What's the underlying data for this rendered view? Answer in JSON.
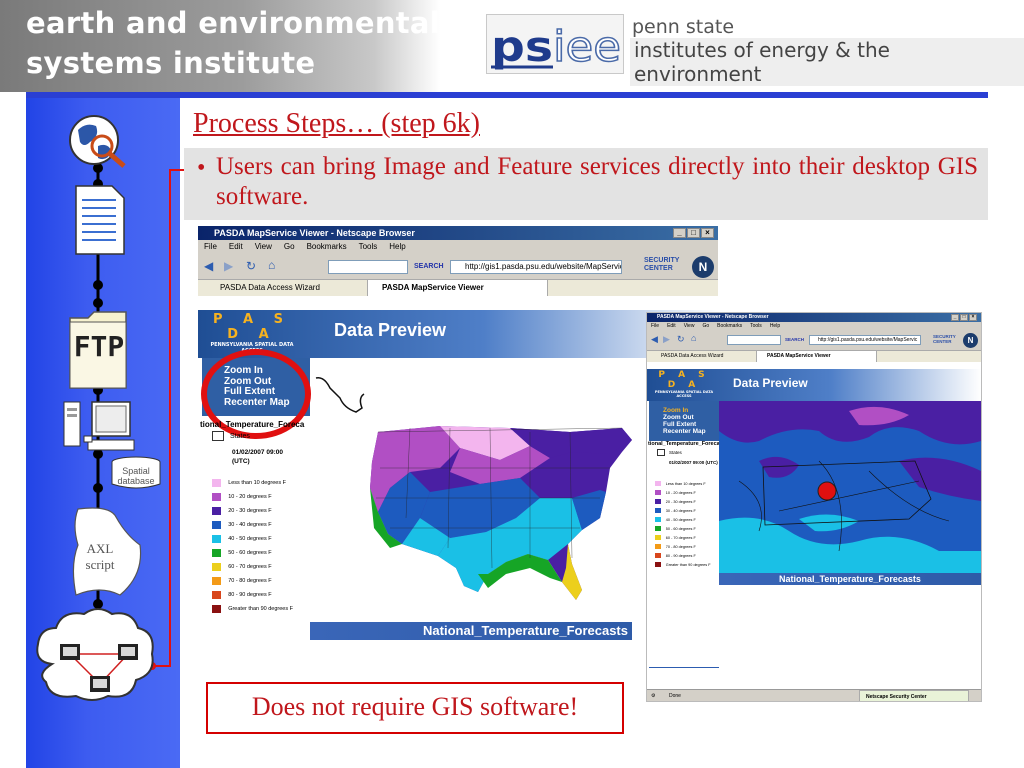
{
  "header": {
    "institute_line1": "earth and environmental",
    "institute_line2": "systems institute",
    "logo_text": "psiee",
    "org_line1": "penn state",
    "org_line2": "institutes of energy & the environment"
  },
  "sidebar": {
    "items": [
      {
        "icon": "globe-magnifier-icon"
      },
      {
        "icon": "document-icon"
      },
      {
        "icon": "ftp-folder-icon",
        "label": "FTP"
      },
      {
        "icon": "computer-workstation-icon"
      },
      {
        "icon": "database-icon",
        "label": "Spatial database"
      },
      {
        "icon": "script-scroll-icon",
        "label": "AXL script"
      },
      {
        "icon": "network-cloud-icon"
      }
    ]
  },
  "slide": {
    "title": "Process Steps… (step 6k)",
    "bullet": "Users can bring Image and Feature services directly into their desktop GIS software.",
    "callout": "Does not require GIS software!"
  },
  "browser_main": {
    "window_title": "PASDA MapService Viewer - Netscape Browser",
    "menu": [
      "File",
      "Edit",
      "View",
      "Go",
      "Bookmarks",
      "Tools",
      "Help"
    ],
    "search_label": "SEARCH",
    "url": "http://gis1.pasda.psu.edu/website/MapServic",
    "security_center": "SECURITY CENTER",
    "tabs": [
      "PASDA Data Access Wizard",
      "PASDA MapService Viewer"
    ],
    "page": {
      "logo": "P A S D A",
      "logo_sub": "PENNSYLVANIA SPATIAL DATA ACCESS",
      "heading": "Data Preview",
      "tools": [
        "Zoom In",
        "Zoom Out",
        "Full Extent",
        "Recenter Map"
      ],
      "legend_title": "tional_Temperature_Foreca",
      "layer_name": "States",
      "timestamp": "01/02/2007 09:00 (UTC)",
      "legend": [
        {
          "label": "Less than 10 degrees F",
          "color": "#f3b5ee"
        },
        {
          "label": "10 - 20 degrees F",
          "color": "#b14fc4"
        },
        {
          "label": "20 - 30 degrees F",
          "color": "#4a1fa3"
        },
        {
          "label": "30 - 40 degrees F",
          "color": "#1d5bbf"
        },
        {
          "label": "40 - 50 degrees F",
          "color": "#1ac0e6"
        },
        {
          "label": "50 - 60 degrees F",
          "color": "#16a526"
        },
        {
          "label": "60 - 70 degrees F",
          "color": "#eccf1c"
        },
        {
          "label": "70 - 80 degrees F",
          "color": "#f39a17"
        },
        {
          "label": "80 - 90 degrees F",
          "color": "#d8461c"
        },
        {
          "label": "Greater than 90 degrees F",
          "color": "#8a1111"
        }
      ],
      "map_title": "National_Temperature_Forecasts"
    }
  },
  "browser_second": {
    "window_title": "PASDA MapService Viewer - Netscape Browser",
    "menu": [
      "File",
      "Edit",
      "View",
      "Go",
      "Bookmarks",
      "Tools",
      "Help"
    ],
    "search_label": "SEARCH",
    "url": "http://gis1.pasda.psu.edu/website/MapServic",
    "security_center": "SECURITY CENTER",
    "tabs": [
      "PASDA Data Access Wizard",
      "PASDA MapService Viewer"
    ],
    "status_left": "Done",
    "status_right": "Netscape Security Center"
  }
}
